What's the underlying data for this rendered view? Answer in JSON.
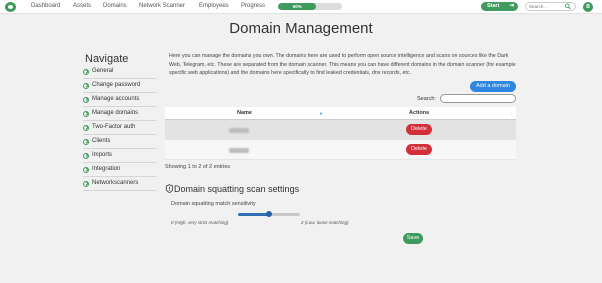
{
  "nav": {
    "items": [
      "Dashboard",
      "Assets",
      "Domains",
      "Network Scanner",
      "Employees",
      "Progress"
    ],
    "progress_label": "60%",
    "progress_value": 0.6,
    "start_label": "Start",
    "search_placeholder": "Search...",
    "avatar_initial": "B"
  },
  "page": {
    "title": "Domain Management"
  },
  "sidebar": {
    "title": "Navigate",
    "items": [
      "General",
      "Change password",
      "Manage accounts",
      "Manage domains",
      "Two-Factor auth",
      "Clients",
      "Imports",
      "Integration",
      "Networkscanners"
    ]
  },
  "intro": "Here you can manage the domains you own. The domains here are used to perform open source intelligence and scans on sources like the Dark Web, Telegram, etc. These are separated from the domain scanner. This means you can have different domains in the domain scanner (for example specific web applications) and the domains here specifically to find leaked credentials, dns records, etc.",
  "add_domain_label": "Add a domain",
  "search_label": "Search:",
  "table": {
    "headers": [
      "Name",
      "Actions"
    ],
    "rows": [
      {
        "action": "Delete"
      },
      {
        "action": "Delete"
      }
    ]
  },
  "entries_text": "Showing 1 to 2 of 2 entries",
  "squatting": {
    "title": "Domain squatting scan settings",
    "sensitivity_label": "Domain squatting match sensitivity",
    "min_label": "0 (High, very strict matching)",
    "max_label": "2 (Low, loose matching)",
    "value": 1,
    "min": 0,
    "max": 2,
    "save_label": "Save"
  },
  "colors": {
    "accent": "#3f9a5e",
    "primary": "#2f86e0",
    "danger": "#d32f3b"
  }
}
